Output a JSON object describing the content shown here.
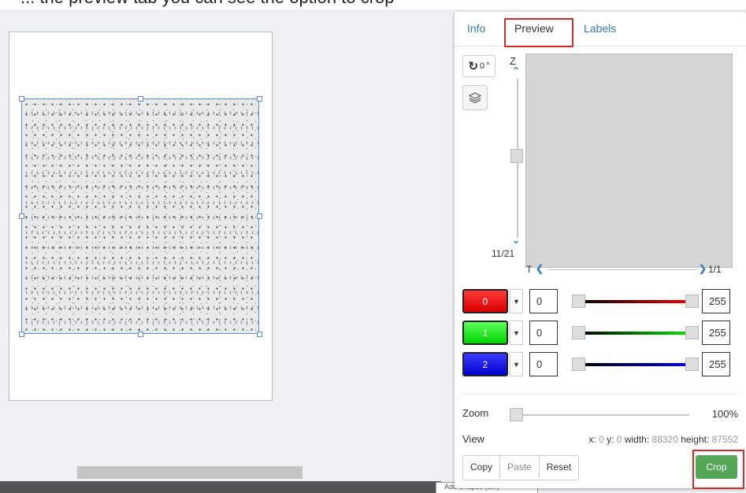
{
  "window": {
    "caption_text": "... the preview tab you can see the option to crop",
    "tooltip_text": "Add Shapes (a...)"
  },
  "panel": {
    "tabs": [
      {
        "label": "Info"
      },
      {
        "label": "Preview",
        "active": true
      },
      {
        "label": "Labels"
      }
    ],
    "rotation": {
      "value": "0",
      "unit": "°"
    },
    "z_axis": {
      "label": "Z",
      "position": "11/21"
    },
    "t_axis": {
      "label": "T",
      "position": "1/1"
    },
    "channels": [
      {
        "index": "0",
        "color": "#ff0000",
        "min": "0",
        "max": "255"
      },
      {
        "index": "1",
        "color": "#00ee00",
        "min": "0",
        "max": "255"
      },
      {
        "index": "2",
        "color": "#0000ff",
        "min": "0",
        "max": "255"
      }
    ],
    "zoom": {
      "label": "Zoom",
      "value": "100%"
    },
    "view": {
      "label": "View",
      "x_label": "x:",
      "x": "0",
      "y_label": "y:",
      "y": "0",
      "width_label": "width:",
      "width": "88320",
      "height_label": "height:",
      "height": "87552"
    },
    "buttons": {
      "copy": "Copy",
      "paste": "Paste",
      "reset": "Reset",
      "crop": "Crop"
    }
  },
  "colors": {
    "accent": "#337ab7",
    "crop_green": "#53a757",
    "highlight_red": "#d52b2b",
    "selection_blue": "#5b8ad6"
  },
  "icons": [
    "rotate-icon",
    "layers-icon",
    "chevron-up-icon",
    "chevron-down-icon",
    "chevron-left-icon",
    "chevron-right-icon",
    "caret-down-icon"
  ]
}
